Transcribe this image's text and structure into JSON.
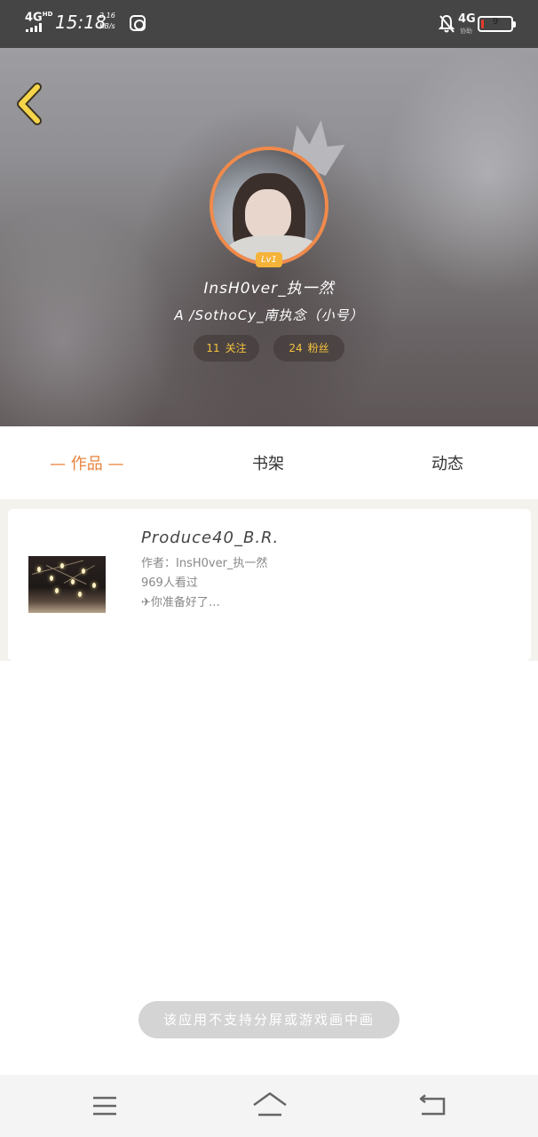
{
  "status_bar": {
    "network": "4G",
    "network_sup": "HD",
    "time": "15:18",
    "speed_value": "2.16",
    "speed_unit": "KB/s",
    "network_right": "4G",
    "network_right_sub": "协助",
    "battery_level": "9",
    "battery_fraction": 0.09,
    "battery_color": "#e23b2b"
  },
  "header": {
    "level": "Lv1",
    "username": "InsH0ver_执一然",
    "alt_account": "A /SothoCy_南执念（小号）",
    "following": {
      "count": "11",
      "label": "关注"
    },
    "fans": {
      "count": "24",
      "label": "粉丝"
    }
  },
  "tabs": {
    "works": "—  作品  —",
    "bookshelf": "书架",
    "feed": "动态"
  },
  "works": [
    {
      "title": "Produce40_B.R.",
      "author": "作者：InsH0ver_执一然",
      "views": "969人看过",
      "desc": "✈你准备好了…"
    }
  ],
  "toast": "该应用不支持分屏或游戏画中画",
  "colors": {
    "accent": "#e8833d",
    "stat_text": "#f4c13d",
    "level_badge": "#f5b33a",
    "avatar_ring": "#f08a4b",
    "back_arrow": "#f5d64a"
  },
  "icons": {
    "back": "chevron-left-icon",
    "crown": "crown-icon",
    "menu": "menu-icon",
    "home": "home-icon",
    "nav_back": "back-icon"
  }
}
